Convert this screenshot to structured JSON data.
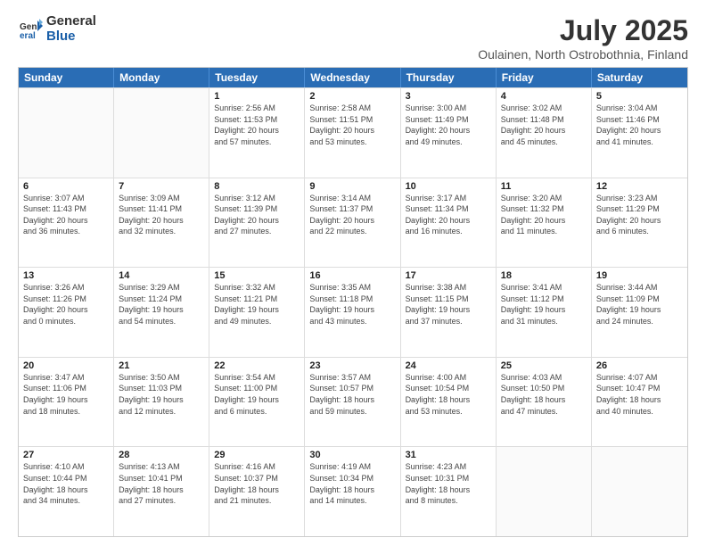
{
  "logo": {
    "general": "General",
    "blue": "Blue"
  },
  "title": "July 2025",
  "subtitle": "Oulainen, North Ostrobothnia, Finland",
  "headers": [
    "Sunday",
    "Monday",
    "Tuesday",
    "Wednesday",
    "Thursday",
    "Friday",
    "Saturday"
  ],
  "weeks": [
    [
      {
        "day": "",
        "info": ""
      },
      {
        "day": "",
        "info": ""
      },
      {
        "day": "1",
        "info": "Sunrise: 2:56 AM\nSunset: 11:53 PM\nDaylight: 20 hours\nand 57 minutes."
      },
      {
        "day": "2",
        "info": "Sunrise: 2:58 AM\nSunset: 11:51 PM\nDaylight: 20 hours\nand 53 minutes."
      },
      {
        "day": "3",
        "info": "Sunrise: 3:00 AM\nSunset: 11:49 PM\nDaylight: 20 hours\nand 49 minutes."
      },
      {
        "day": "4",
        "info": "Sunrise: 3:02 AM\nSunset: 11:48 PM\nDaylight: 20 hours\nand 45 minutes."
      },
      {
        "day": "5",
        "info": "Sunrise: 3:04 AM\nSunset: 11:46 PM\nDaylight: 20 hours\nand 41 minutes."
      }
    ],
    [
      {
        "day": "6",
        "info": "Sunrise: 3:07 AM\nSunset: 11:43 PM\nDaylight: 20 hours\nand 36 minutes."
      },
      {
        "day": "7",
        "info": "Sunrise: 3:09 AM\nSunset: 11:41 PM\nDaylight: 20 hours\nand 32 minutes."
      },
      {
        "day": "8",
        "info": "Sunrise: 3:12 AM\nSunset: 11:39 PM\nDaylight: 20 hours\nand 27 minutes."
      },
      {
        "day": "9",
        "info": "Sunrise: 3:14 AM\nSunset: 11:37 PM\nDaylight: 20 hours\nand 22 minutes."
      },
      {
        "day": "10",
        "info": "Sunrise: 3:17 AM\nSunset: 11:34 PM\nDaylight: 20 hours\nand 16 minutes."
      },
      {
        "day": "11",
        "info": "Sunrise: 3:20 AM\nSunset: 11:32 PM\nDaylight: 20 hours\nand 11 minutes."
      },
      {
        "day": "12",
        "info": "Sunrise: 3:23 AM\nSunset: 11:29 PM\nDaylight: 20 hours\nand 6 minutes."
      }
    ],
    [
      {
        "day": "13",
        "info": "Sunrise: 3:26 AM\nSunset: 11:26 PM\nDaylight: 20 hours\nand 0 minutes."
      },
      {
        "day": "14",
        "info": "Sunrise: 3:29 AM\nSunset: 11:24 PM\nDaylight: 19 hours\nand 54 minutes."
      },
      {
        "day": "15",
        "info": "Sunrise: 3:32 AM\nSunset: 11:21 PM\nDaylight: 19 hours\nand 49 minutes."
      },
      {
        "day": "16",
        "info": "Sunrise: 3:35 AM\nSunset: 11:18 PM\nDaylight: 19 hours\nand 43 minutes."
      },
      {
        "day": "17",
        "info": "Sunrise: 3:38 AM\nSunset: 11:15 PM\nDaylight: 19 hours\nand 37 minutes."
      },
      {
        "day": "18",
        "info": "Sunrise: 3:41 AM\nSunset: 11:12 PM\nDaylight: 19 hours\nand 31 minutes."
      },
      {
        "day": "19",
        "info": "Sunrise: 3:44 AM\nSunset: 11:09 PM\nDaylight: 19 hours\nand 24 minutes."
      }
    ],
    [
      {
        "day": "20",
        "info": "Sunrise: 3:47 AM\nSunset: 11:06 PM\nDaylight: 19 hours\nand 18 minutes."
      },
      {
        "day": "21",
        "info": "Sunrise: 3:50 AM\nSunset: 11:03 PM\nDaylight: 19 hours\nand 12 minutes."
      },
      {
        "day": "22",
        "info": "Sunrise: 3:54 AM\nSunset: 11:00 PM\nDaylight: 19 hours\nand 6 minutes."
      },
      {
        "day": "23",
        "info": "Sunrise: 3:57 AM\nSunset: 10:57 PM\nDaylight: 18 hours\nand 59 minutes."
      },
      {
        "day": "24",
        "info": "Sunrise: 4:00 AM\nSunset: 10:54 PM\nDaylight: 18 hours\nand 53 minutes."
      },
      {
        "day": "25",
        "info": "Sunrise: 4:03 AM\nSunset: 10:50 PM\nDaylight: 18 hours\nand 47 minutes."
      },
      {
        "day": "26",
        "info": "Sunrise: 4:07 AM\nSunset: 10:47 PM\nDaylight: 18 hours\nand 40 minutes."
      }
    ],
    [
      {
        "day": "27",
        "info": "Sunrise: 4:10 AM\nSunset: 10:44 PM\nDaylight: 18 hours\nand 34 minutes."
      },
      {
        "day": "28",
        "info": "Sunrise: 4:13 AM\nSunset: 10:41 PM\nDaylight: 18 hours\nand 27 minutes."
      },
      {
        "day": "29",
        "info": "Sunrise: 4:16 AM\nSunset: 10:37 PM\nDaylight: 18 hours\nand 21 minutes."
      },
      {
        "day": "30",
        "info": "Sunrise: 4:19 AM\nSunset: 10:34 PM\nDaylight: 18 hours\nand 14 minutes."
      },
      {
        "day": "31",
        "info": "Sunrise: 4:23 AM\nSunset: 10:31 PM\nDaylight: 18 hours\nand 8 minutes."
      },
      {
        "day": "",
        "info": ""
      },
      {
        "day": "",
        "info": ""
      }
    ]
  ]
}
